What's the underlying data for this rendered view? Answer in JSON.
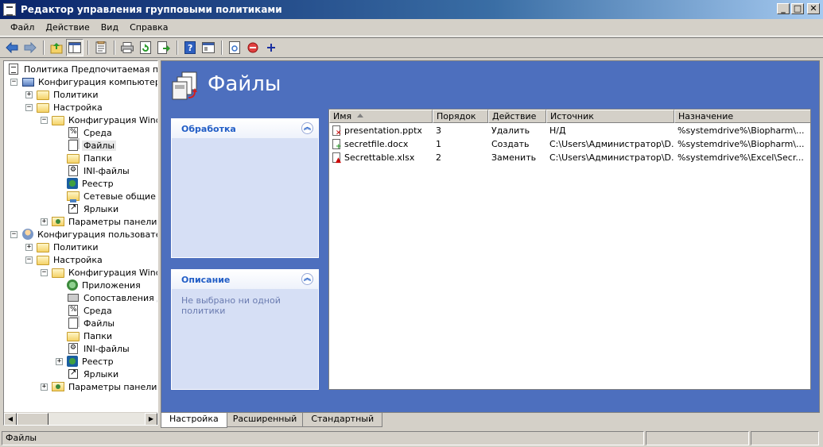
{
  "window": {
    "title": "Редактор управления групповыми политиками"
  },
  "menu": [
    "Файл",
    "Действие",
    "Вид",
    "Справка"
  ],
  "toolbar": {
    "icons": [
      "back-arrow-icon",
      "forward-arrow-icon",
      "up-folder-icon",
      "show-tree-icon",
      "properties-icon",
      "print-icon",
      "refresh-icon",
      "export-icon",
      "help-icon",
      "console-icon",
      "file-item-icon",
      "stop-icon",
      "add-icon"
    ]
  },
  "tree": {
    "root": "Политика Предпочитаемая полит",
    "computer_config": "Конфигурация компьютера",
    "user_config": "Конфигурация пользователя",
    "policies": "Политики",
    "settings": "Настройка",
    "windows_config": "Конфигурация Window",
    "control_panel": "Параметры панели уп",
    "c_items": [
      "Среда",
      "Файлы",
      "Папки",
      "INI-файлы",
      "Реестр",
      "Сетевые общие р",
      "Ярлыки"
    ],
    "u_items": [
      "Приложения",
      "Сопоставления ди",
      "Среда",
      "Файлы",
      "Папки",
      "INI-файлы",
      "Реестр",
      "Ярлыки"
    ]
  },
  "main": {
    "title": "Файлы",
    "processing_panel": {
      "title": "Обработка"
    },
    "description_panel": {
      "title": "Описание",
      "text": "Не выбрано ни одной политики"
    }
  },
  "list": {
    "columns": [
      "Имя",
      "Порядок",
      "Действие",
      "Источник",
      "Назначение"
    ],
    "rows": [
      {
        "name": "presentation.pptx",
        "order": "3",
        "action": "Удалить",
        "source": "Н/Д",
        "target": "%systemdrive%\\Biopharm\\...",
        "mark_color": "#cc0000",
        "mark": "✕"
      },
      {
        "name": "secretfile.docx",
        "order": "1",
        "action": "Создать",
        "source": "C:\\Users\\Администратор\\D...",
        "target": "%systemdrive%\\Biopharm\\...",
        "mark_color": "#2a9a2a",
        "mark": "+"
      },
      {
        "name": "Secrettable.xlsx",
        "order": "2",
        "action": "Заменить",
        "source": "C:\\Users\\Администратор\\D...",
        "target": "%systemdrive%\\Excel\\Secr...",
        "mark_color": "#cc0000",
        "mark": "▲"
      }
    ]
  },
  "tabs": [
    "Настройка",
    "Расширенный",
    "Стандартный"
  ],
  "status": {
    "text": "Файлы"
  }
}
